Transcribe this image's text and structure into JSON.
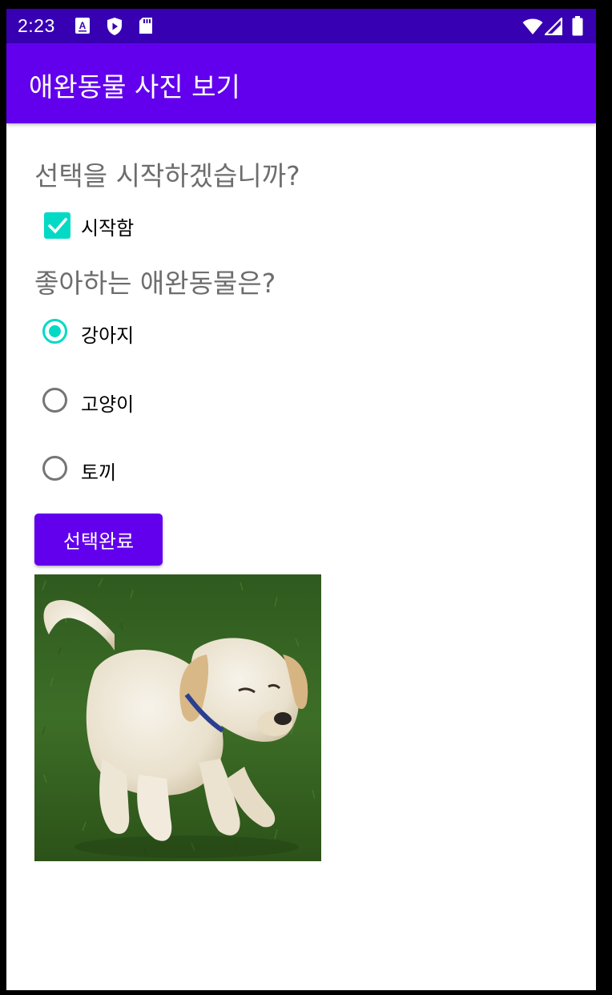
{
  "status_bar": {
    "time": "2:23",
    "left_icons": [
      "font-icon",
      "shield-play-icon",
      "sd-card-icon"
    ],
    "right_icons": [
      "wifi-icon",
      "signal-icon",
      "battery-icon"
    ],
    "color": "#3700B3"
  },
  "app_bar": {
    "title": "애완동물 사진 보기",
    "color": "#6200EE"
  },
  "main": {
    "start_question": "선택을 시작하겠습니까?",
    "start_checkbox": {
      "label": "시작함",
      "checked": true
    },
    "pet_question": "좋아하는 애완동물은?",
    "pets": [
      {
        "label": "강아지",
        "selected": true
      },
      {
        "label": "고양이",
        "selected": false
      },
      {
        "label": "토끼",
        "selected": false
      }
    ],
    "done_button": "선택완료",
    "image_subject": "puppy-image",
    "accent_color": "#03DAC5"
  }
}
